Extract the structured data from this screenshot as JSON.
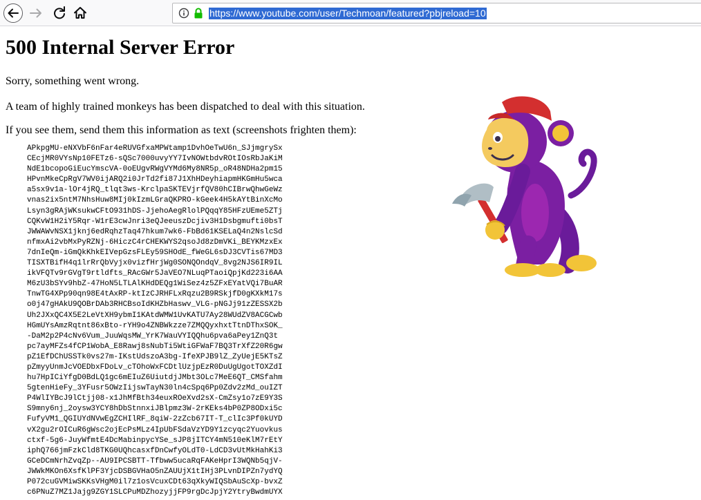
{
  "browser": {
    "url": "https://www.youtube.com/user/Techmoan/featured?pbjreload=10",
    "icons": [
      "back-arrow-icon",
      "forward-arrow-icon",
      "reload-icon",
      "home-icon",
      "info-icon",
      "lock-icon"
    ]
  },
  "page": {
    "title": "500 Internal Server Error",
    "paragraphs": [
      "Sorry, something went wrong.",
      "A team of highly trained monkeys has been dispatched to deal with this situation.",
      "If you see them, send them this information as text (screenshots frighten them):"
    ],
    "error_lines": [
      "APkpgMU-eNXVbF6nFar4eRUVGfxaMPWtamp1DvhOeTwU6n_SJjmgrySx",
      "CEcjMR0VYsNp10FETz6-sQSc7000uvyYY7IvNOWtbdvROtIOsRbJaKiM",
      "NdE1bcopoGiEucYmscVA-0oEUgvRWgVYMd6My8NR5p_oR48NDHa2pm15",
      "HPvnMkeCpRgV7WV0ijARQ2i0JrTd2fi87J1XhHDeyhiapmHKGmHu5wca",
      "a5sx9v1a-lOr4jRQ_tlqt3ws-KrclpaSKTEVjrfQV80hCIBrwQhwGeWz",
      "vnas2ix5ntM7NhsHuw8MIj0kIzmLGraQKPRO-kGeek4H5kAYtBinXcMo",
      "Lsyn3gRAjWKsukwCFtO931hDS-JjehoAegRlolPQqqY85HFzUEme5ZTj",
      "CQKvW1H2iY5Rqr-W1rE3cwJnri3eQJeeuszDcjiv3H1Dsbgmufti0bsT",
      "JWWAWvNSX1jknj6edRqhzTaq47hkum7wk6-FbBd61KSELaQ4n2NslcSd",
      "nfmxAi2vbMxPyRZNj-6HiczC4rCHEKWYS2qsoJd8zDmVKi_BEYKMzxEx",
      "7dnIeQm-iGmQkKhkEIVepGzsFLEy59SHOdE_fWeGL6sDJ3CVTis67MD3",
      "TISXTBifH4q1lrRrQbVyjx0vizfHrjWg0SONQOndqV_8vg2NJS6IR9IL",
      "ikVFQTv9rGVgT9rtldfts_RAcGWr5JaVEO7NLuqPTaoiQpjKd223i6AA",
      "M6zU3bSYv9hbZ-47HoN5LTLAlKHdDEQg1WiSez4z5ZFxEYatVQi7BuAR",
      "TnwTG4XPp90qn98E4tAxRP-ktIzCJRHFLxRqzu2B9RSkjfD0gKXkM17s",
      "o0j47gHAkU9QOBrDAb3RHCBsoIdKHZbHaswv_VLG-pNGJj91zZESSX2b",
      "Uh2JXxQC4X5E2LeVtXH9ybmI1KAtdWMW1UvKATU7Ay28WUdZV8ACGCwb",
      "HGmUYsAmzRqtnt86xBto-rYH9o4ZNBWkzze7ZMQQyxhxtTtnDThxSOK_",
      "-DaM2p2P4cNv6Vum_JuuWqsMW_YrK7WauVYIQQhu6pva6aPey1ZnQ3t",
      "pc7ayMFZs4fCP1WobA_E8Rawj8sNubTi5WtiGFWaF7BQ3TrXfZ20R6gw",
      "pZ1EfDChUSSTk0vs27m-IKstUdszoA3bg-IfeXPJB9lZ_ZyUejE5KTsZ",
      "pZmyyUnmJcVOEDbxFDoLv_cTOhoWxFCDtlUzjpEzR0DuUgUgotTOXZdI",
      "hu7HpICiYfgD0BdLQ1gc6mEIuZ6UiutdjJMbt3OLc7MeE6QT_CMSfahm",
      "5gtenHieFy_3YFusr5OWzIijswTayN30ln4cSpq6Pp0Zdv2zMd_ouIZT",
      "P4WlIYBcJ9lCtjj08-x1JhMfBth34euxROeXvd2sX-CmZsy1o7zE9Y3S",
      "S9mny6nj_2oysw3YCY8hDbStnnxiJBlpmz3W-2rKEks4bP0ZP8ODxi5c",
      "FufyVM1_QGIUYdNVwEgZCHIlRF_8qiW-2zZcb67IT-T_clIc3Pf0kUYD",
      "vX2gu2rOICuR6gWsc2ojEcPsMLz4IpUbFSdaVzYD9Y1zcyqc2Yuovkus",
      "ctxf-5g6-JuyWfmtE4DcMabinpycYSe_sJP8jITCY4mN510eKlM7rEtY",
      "iphQ766jmFzkCld8TKG0UQhcasxfDnCwfyOLdT0-LdCD3vUtMkHahKi3",
      "GCeDCmNrhZvqZp--AU9IPCSBTT-Tfbww5ucaRqFAKeHprI3WQNb5qjV-",
      "JWWkMKOn6XsfKlPF3YjcDSBGVHaO5nZAUUjX1tIHj3PLvnDIPZn7ydYQ",
      "P072cuGVMiwSKKsVHgM0il7z1osVcuxCDt63qXkyWIQSbAuScXp-bvxZ",
      "c6PNuZ7MZ1Jajg9ZGY1SLCPuMDZhozyjjFP9rgDcJpjY2YtryBwdmUYX"
    ],
    "illustration": "monkey-with-hammer-illustration"
  }
}
